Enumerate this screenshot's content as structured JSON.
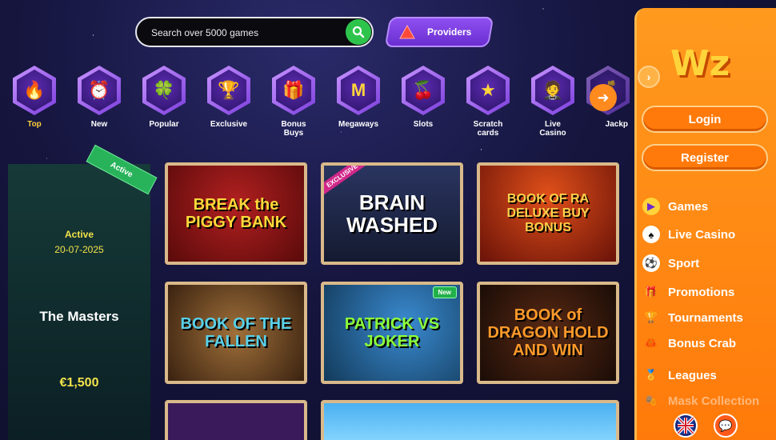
{
  "search": {
    "placeholder": "Search over 5000 games"
  },
  "providers_label": "Providers",
  "categories": [
    {
      "label": "Top",
      "icon": "flame-icon",
      "glyph": "🔥"
    },
    {
      "label": "New",
      "icon": "alarm-clock-icon",
      "glyph": "⏰"
    },
    {
      "label": "Popular",
      "icon": "clover-icon",
      "glyph": "🍀"
    },
    {
      "label": "Exclusive",
      "icon": "trophy-icon",
      "glyph": "🏆"
    },
    {
      "label": "Bonus\nBuys",
      "icon": "gift-icon",
      "glyph": "🎁"
    },
    {
      "label": "Megaways",
      "icon": "megaways-icon",
      "glyph": "M"
    },
    {
      "label": "Slots",
      "icon": "cherries-icon",
      "glyph": "🍒"
    },
    {
      "label": "Scratch\ncards",
      "icon": "scratch-card-icon",
      "glyph": "★"
    },
    {
      "label": "Live\nCasino",
      "icon": "dealer-icon",
      "glyph": "🤵"
    },
    {
      "label": "Jackp",
      "icon": "jackpot-icon",
      "glyph": "💰"
    }
  ],
  "tournament": {
    "ribbon": "Active",
    "status": "Active",
    "date": "20-07-2025",
    "name": "The Masters",
    "prize": "€1,500"
  },
  "games": [
    {
      "title": "BREAK the PIGGY BANK",
      "bg": "#7a1414",
      "color": "#ffd93a",
      "badge": ""
    },
    {
      "title": "BRAIN WASHED",
      "bg": "#1c2340",
      "color": "#ffffff",
      "badge": "EXCLUSIVE"
    },
    {
      "title": "BOOK OF RA DELUXE BUY BONUS",
      "bg": "#8a1c12",
      "color": "#ffd04a",
      "badge": ""
    },
    {
      "title": "BOOK OF THE FALLEN",
      "bg": "#5a3a1c",
      "color": "#5ad0e8",
      "badge": ""
    },
    {
      "title": "PATRICK VS JOKER",
      "bg": "#1b4d7a",
      "color": "#8cff3a",
      "badge": "New"
    },
    {
      "title": "BOOK of DRAGON HOLD AND WIN",
      "bg": "#2c1a10",
      "color": "#ff9a2a",
      "badge": ""
    }
  ],
  "sidebar": {
    "logo": "Wz",
    "login": "Login",
    "register": "Register",
    "nav": [
      {
        "label": "Games",
        "icon": "play-icon",
        "glyph": "▶",
        "color": "#6a2ad0"
      },
      {
        "label": "Live Casino",
        "icon": "cards-icon",
        "glyph": "♠",
        "color": "#ffffff"
      },
      {
        "label": "Sport",
        "icon": "soccer-ball-icon",
        "glyph": "⚽",
        "color": "#ffffff"
      },
      {
        "label": "Promotions",
        "icon": "gift-icon",
        "glyph": "🎁",
        "color": "#3ab04a"
      },
      {
        "label": "Tournaments",
        "icon": "trophy-icon",
        "glyph": "🏆",
        "color": "#ffd43a"
      },
      {
        "label": "Bonus Crab",
        "icon": "crab-icon",
        "glyph": "🦀",
        "color": "#ffa31a"
      },
      {
        "label": "Leagues",
        "icon": "leagues-icon",
        "glyph": "🏅",
        "color": "#2a6ad0"
      },
      {
        "label": "Mask Collection",
        "icon": "mask-icon",
        "glyph": "🎭",
        "color": "#ffa31a"
      }
    ]
  }
}
